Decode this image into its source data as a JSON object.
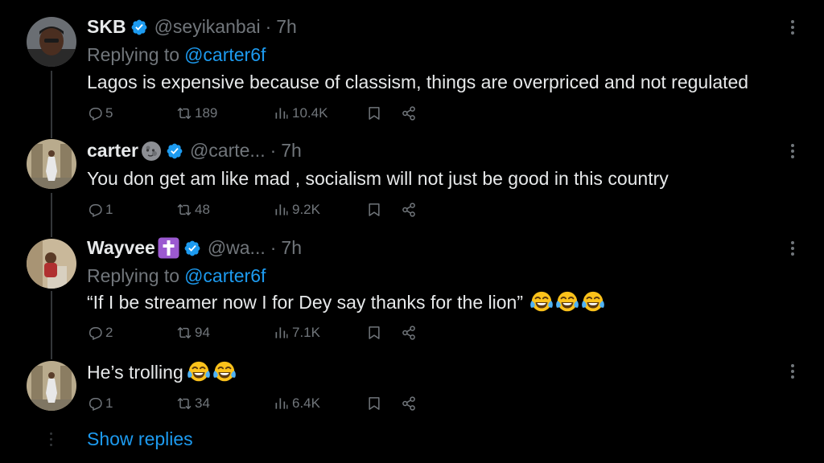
{
  "tweets": [
    {
      "name": "SKB",
      "name_emoji": "",
      "handle": "@seyikanbai",
      "time": "7h",
      "replying_prefix": "Replying to",
      "replying_to": "@carter6f",
      "text": "Lagos is expensive because of classism, things are overpriced and not regulated",
      "replies": "5",
      "retweets": "189",
      "views": "10.4K"
    },
    {
      "name": "carter",
      "name_emoji": "new-moon-face-emoji",
      "handle": "@carte...",
      "time": "7h",
      "text": "You don get am like mad , socialism will not just be good in this country",
      "replies": "1",
      "retweets": "48",
      "views": "9.2K"
    },
    {
      "name": "Wayvee",
      "name_emoji": "latin-cross-emoji",
      "handle": "@wa...",
      "time": "7h",
      "replying_prefix": "Replying to",
      "replying_to": "@carter6f",
      "text": "“If I be streamer now I for Dey say thanks for the lion”",
      "text_emojis": [
        "tears-of-joy-emoji",
        "tears-of-joy-emoji",
        "tears-of-joy-emoji"
      ],
      "replies": "2",
      "retweets": "94",
      "views": "7.1K"
    },
    {
      "text": "He’s trolling",
      "text_emojis": [
        "tears-of-joy-emoji",
        "tears-of-joy-emoji"
      ],
      "replies": "1",
      "retweets": "34",
      "views": "6.4K"
    }
  ],
  "show_replies": "Show replies",
  "colors": {
    "background": "#000000",
    "primary_text": "#e7e9ea",
    "secondary_text": "#71767b",
    "accent": "#1d9bf0",
    "thread_line": "#333639"
  }
}
